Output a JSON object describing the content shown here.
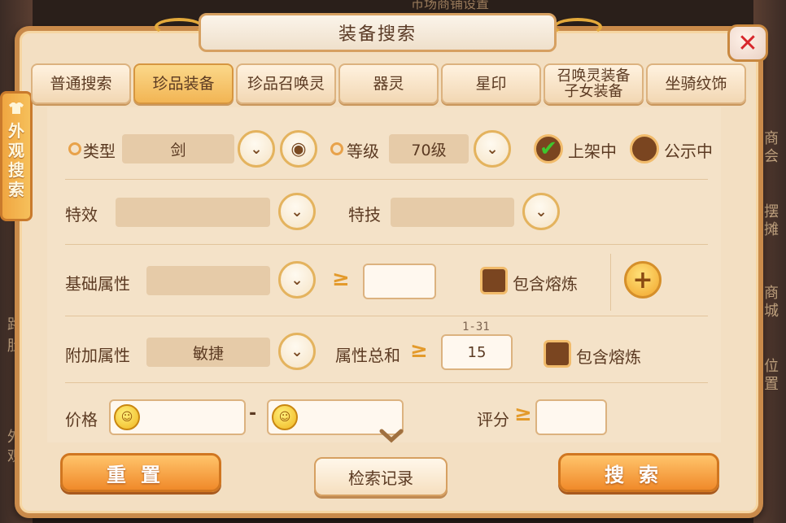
{
  "background": {
    "top_text": "市场商铺设置",
    "left_texts": [
      "路",
      "肚",
      "外",
      "观"
    ],
    "right_texts": [
      "商会",
      "摆摊",
      "商城",
      "位置"
    ]
  },
  "window": {
    "title": "装备搜索",
    "close_symbol": "✕"
  },
  "side_tab": {
    "label": "外观搜索",
    "icon": "shirt-icon"
  },
  "tabs": [
    {
      "label": "普通搜索",
      "active": false
    },
    {
      "label": "珍品装备",
      "active": true
    },
    {
      "label": "珍品召唤灵",
      "active": false
    },
    {
      "label": "器灵",
      "active": false
    },
    {
      "label": "星印",
      "active": false
    },
    {
      "label": "召唤灵装备\n子女装备",
      "active": false
    },
    {
      "label": "坐骑纹饰",
      "active": false
    }
  ],
  "form": {
    "type_label": "类型",
    "type_value": "剑",
    "level_label": "等级",
    "level_value": "70级",
    "on_sale_label": "上架中",
    "on_sale_checked": true,
    "publicity_label": "公示中",
    "publicity_checked": false,
    "effect_label": "特效",
    "effect_value": "",
    "skill_label": "特技",
    "skill_value": "",
    "base_attr_label": "基础属性",
    "base_attr_value": "",
    "base_attr_compare": "≥",
    "base_attr_input": "",
    "base_attr_include_label": "包含熔炼",
    "extra_attr_label": "附加属性",
    "extra_attr_value": "敏捷",
    "attr_total_label": "属性总和",
    "attr_total_compare": "≥",
    "attr_total_hint": "1-31",
    "attr_total_value": "15",
    "extra_attr_include_label": "包含熔炼",
    "price_label": "价格",
    "price_min": "",
    "price_max": "",
    "price_separator": "-",
    "score_label": "评分",
    "score_compare": "≥",
    "score_value": ""
  },
  "buttons": {
    "reset": "重置",
    "history": "检索记录",
    "search": "搜索"
  },
  "colors": {
    "panel": "#f3dfc2",
    "accent": "#f08a2a",
    "border": "#c98a4a",
    "close": "#d7262b"
  }
}
